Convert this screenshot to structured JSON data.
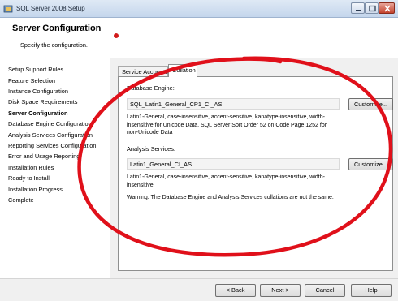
{
  "window": {
    "title": "SQL Server 2008 Setup"
  },
  "header": {
    "title": "Server Configuration",
    "subtitle": "Specify the configuration."
  },
  "nav": {
    "items": [
      {
        "label": "Setup Support Rules"
      },
      {
        "label": "Feature Selection"
      },
      {
        "label": "Instance Configuration"
      },
      {
        "label": "Disk Space Requirements"
      },
      {
        "label": "Server Configuration",
        "active": true
      },
      {
        "label": "Database Engine Configuration"
      },
      {
        "label": "Analysis Services Configuration"
      },
      {
        "label": "Reporting Services Configuration"
      },
      {
        "label": "Error and Usage Reporting"
      },
      {
        "label": "Installation Rules"
      },
      {
        "label": "Ready to Install"
      },
      {
        "label": "Installation Progress"
      },
      {
        "label": "Complete"
      }
    ]
  },
  "tabs": [
    {
      "label": "Service Accounts"
    },
    {
      "label": "Collation",
      "selected": true
    }
  ],
  "collation": {
    "db_engine_label": "Database Engine:",
    "db_engine_value": "SQL_Latin1_General_CP1_CI_AS",
    "db_engine_desc": "Latin1-General, case-insensitive, accent-sensitive, kanatype-insensitive, width-insensitive for Unicode Data, SQL Server Sort Order 52 on Code Page 1252 for non-Unicode Data",
    "as_label": "Analysis Services:",
    "as_value": "Latin1_General_CI_AS",
    "as_desc": "Latin1-General, case-insensitive, accent-sensitive, kanatype-insensitive, width-insensitive",
    "warning": "Warning: The Database Engine and Analysis Services collations are not the same.",
    "customize_label": "Customize..."
  },
  "footer": {
    "back": "< Back",
    "next": "Next >",
    "cancel": "Cancel",
    "help": "Help"
  },
  "colors": {
    "annotation": "#e0101a"
  }
}
